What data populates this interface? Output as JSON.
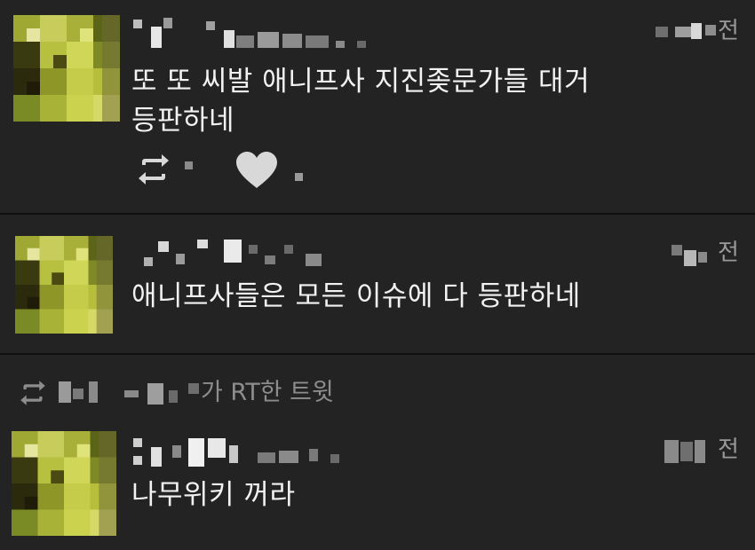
{
  "tweets": [
    {
      "time_suffix": "전",
      "text_line1": "또 또 씨발 애니프사 지진좆문가들 대거",
      "text_line2": "등판하네",
      "retweet_icon": "retweet-icon",
      "like_icon": "heart-icon"
    },
    {
      "time_suffix": "전",
      "text_line1": "애니프사들은 모든 이슈에 다 등판하네"
    },
    {
      "retweet_notice": "가 RT한 트윗",
      "retweet_notice_icon": "retweet-icon",
      "time_suffix": "전",
      "text_line1": "나무위키 꺼라"
    }
  ],
  "colors": {
    "background": "#232323",
    "divider": "#0f0f0f",
    "text": "#f2f2f2",
    "muted": "#8d8d8d"
  }
}
